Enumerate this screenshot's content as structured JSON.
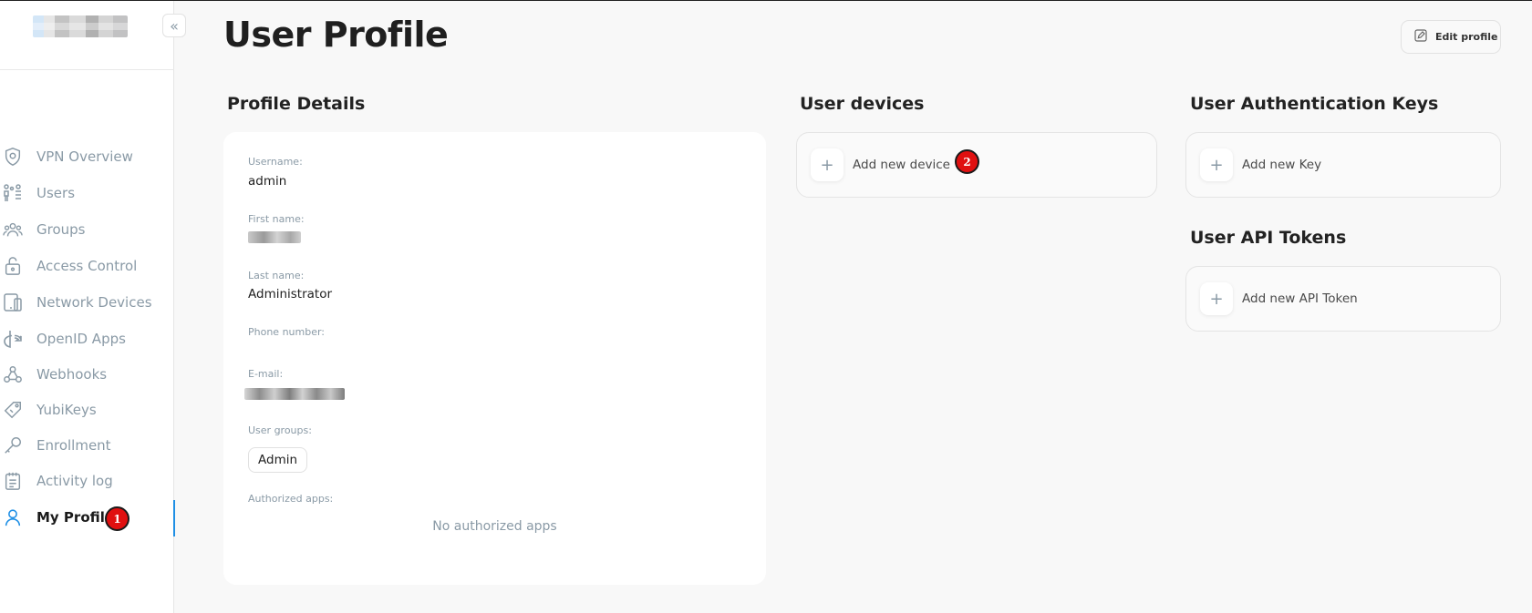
{
  "page": {
    "title": "User Profile",
    "edit_label": "Edit profile"
  },
  "sidebar": {
    "items": [
      {
        "label": "VPN Overview",
        "icon": "shield-icon"
      },
      {
        "label": "Users",
        "icon": "users-icon"
      },
      {
        "label": "Groups",
        "icon": "groups-icon"
      },
      {
        "label": "Access Control",
        "icon": "lock-icon"
      },
      {
        "label": "Network Devices",
        "icon": "devices-icon"
      },
      {
        "label": "OpenID Apps",
        "icon": "openid-icon"
      },
      {
        "label": "Webhooks",
        "icon": "webhook-icon"
      },
      {
        "label": "YubiKeys",
        "icon": "key-tag-icon"
      },
      {
        "label": "Enrollment",
        "icon": "wrench-icon"
      },
      {
        "label": "Activity log",
        "icon": "activity-log-icon"
      },
      {
        "label": "My Profile",
        "icon": "user-icon",
        "active": true
      }
    ]
  },
  "annotations": {
    "badge1": "1",
    "badge2": "2"
  },
  "profile": {
    "section_title": "Profile Details",
    "username_label": "Username:",
    "username": "admin",
    "first_name_label": "First name:",
    "last_name_label": "Last name:",
    "last_name": "Administrator",
    "phone_label": "Phone number:",
    "email_label": "E-mail:",
    "groups_label": "User groups:",
    "groups": [
      "Admin"
    ],
    "apps_label": "Authorized apps:",
    "apps_empty": "No authorized apps"
  },
  "devices": {
    "section_title": "User devices",
    "add_label": "Add new device"
  },
  "auth_keys": {
    "section_title": "User Authentication Keys",
    "add_label": "Add new Key"
  },
  "api_tokens": {
    "section_title": "User API Tokens",
    "add_label": "Add new API Token"
  },
  "colors": {
    "accent": "#1f8fe5",
    "muted": "#8a9aa6",
    "badge": "#e01010"
  }
}
